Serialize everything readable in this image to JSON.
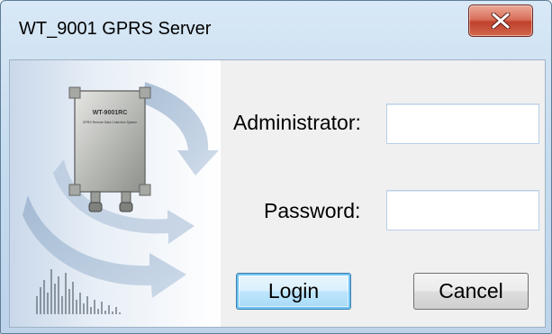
{
  "window": {
    "title": "WT_9001 GPRS Server",
    "close_glyph": "X"
  },
  "art": {
    "device_label": "WT-9001RC",
    "device_sublabel": "GPRS Remote Data Collection System"
  },
  "form": {
    "administrator_label": "Administrator:",
    "administrator_value": "",
    "password_label": "Password:",
    "password_value": ""
  },
  "buttons": {
    "login_label": "Login",
    "cancel_label": "Cancel"
  },
  "colors": {
    "title_bar": "#c6dcef",
    "close_button": "#c7452f",
    "default_button_border": "#3c7fb1"
  }
}
